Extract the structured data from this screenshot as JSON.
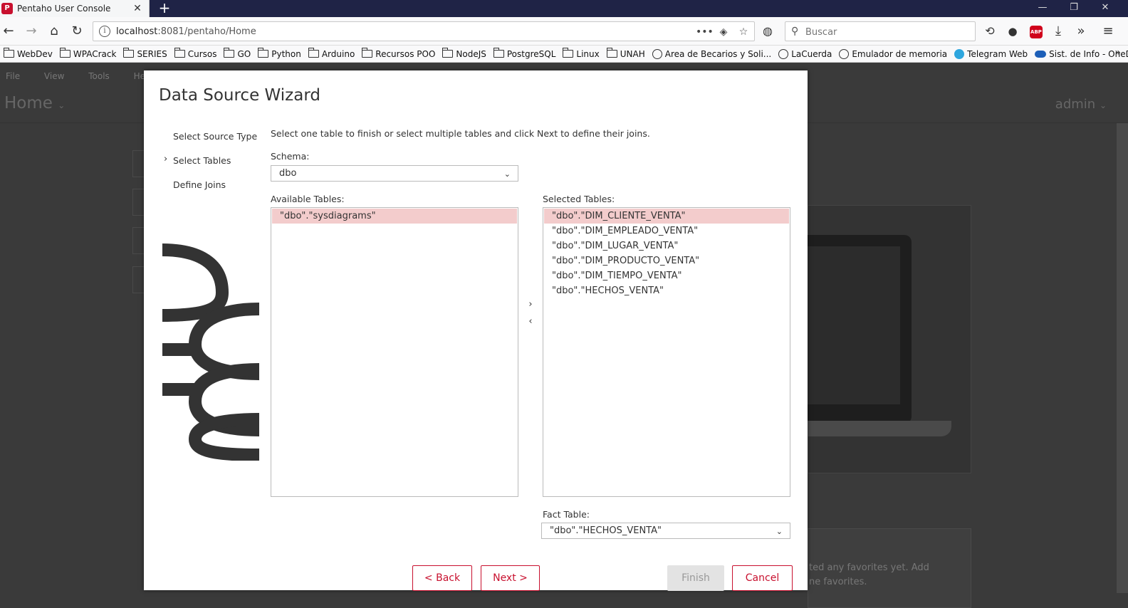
{
  "browser": {
    "tab_title": "Pentaho User Console",
    "url_host": "localhost",
    "url_rest": ":8081/pentaho/Home",
    "search_placeholder": "Buscar",
    "abp_label": "ABP"
  },
  "bookmarks": [
    {
      "label": "WebDev",
      "icon": "folder"
    },
    {
      "label": "WPACrack",
      "icon": "folder"
    },
    {
      "label": "SERIES",
      "icon": "folder"
    },
    {
      "label": "Cursos",
      "icon": "folder"
    },
    {
      "label": "GO",
      "icon": "folder"
    },
    {
      "label": "Python",
      "icon": "folder"
    },
    {
      "label": "Arduino",
      "icon": "folder"
    },
    {
      "label": "Recursos POO",
      "icon": "folder"
    },
    {
      "label": "NodeJS",
      "icon": "folder"
    },
    {
      "label": "PostgreSQL",
      "icon": "folder"
    },
    {
      "label": "Linux",
      "icon": "folder"
    },
    {
      "label": "UNAH",
      "icon": "folder"
    },
    {
      "label": "Area de Becarios y Soli...",
      "icon": "globe"
    },
    {
      "label": "LaCuerda",
      "icon": "globe"
    },
    {
      "label": "Emulador de memoria",
      "icon": "globe"
    },
    {
      "label": "Telegram Web",
      "icon": "telegram"
    },
    {
      "label": "Sist. de Info - OneDrive",
      "icon": "onedrive"
    }
  ],
  "app": {
    "menu": [
      "File",
      "View",
      "Tools",
      "Help"
    ],
    "home_label": "Home",
    "user_label": "admin",
    "favorites_text": "ted any favorites yet. Add",
    "favorites_text2": "ne favorites."
  },
  "dialog": {
    "title": "Data Source Wizard",
    "steps": [
      "Select Source Type",
      "Select Tables",
      "Define Joins"
    ],
    "active_step": "Select Tables",
    "instruction": "Select one table to finish or select multiple tables and click Next to define their joins.",
    "schema_label": "Schema:",
    "schema_value": "dbo",
    "available_label": "Available Tables:",
    "available_tables": [
      "\"dbo\".\"sysdiagrams\""
    ],
    "selected_label": "Selected Tables:",
    "selected_tables": [
      "\"dbo\".\"DIM_CLIENTE_VENTA\"",
      "\"dbo\".\"DIM_EMPLEADO_VENTA\"",
      "\"dbo\".\"DIM_LUGAR_VENTA\"",
      "\"dbo\".\"DIM_PRODUCTO_VENTA\"",
      "\"dbo\".\"DIM_TIEMPO_VENTA\"",
      "\"dbo\".\"HECHOS_VENTA\""
    ],
    "fact_label": "Fact Table:",
    "fact_value": "\"dbo\".\"HECHOS_VENTA\"",
    "buttons": {
      "back": "< Back",
      "next": "Next >",
      "finish": "Finish",
      "cancel": "Cancel"
    }
  },
  "colors": {
    "accent": "#c8102e",
    "selection": "#f3cccc"
  }
}
